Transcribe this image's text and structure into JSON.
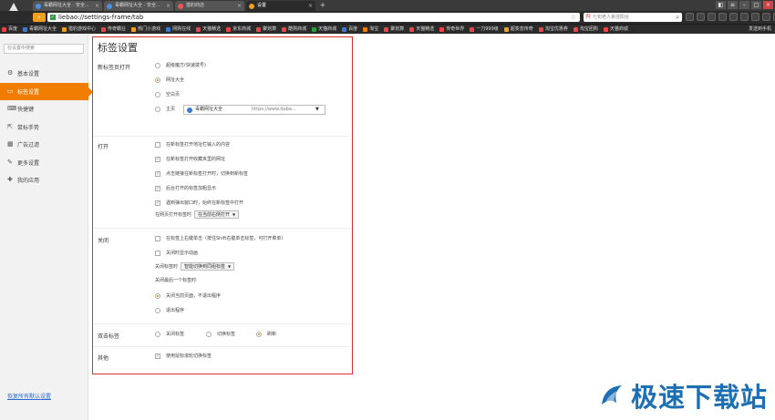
{
  "tabs": [
    {
      "label": "毒霸网址大全 - 安全...",
      "active": false
    },
    {
      "label": "毒霸网址大全 - 安全...",
      "active": false
    },
    {
      "label": "猎豹商店",
      "active": false
    },
    {
      "label": "设置",
      "active": true
    }
  ],
  "address": {
    "url": "liebao://settings-frame/tab"
  },
  "search": {
    "value": "七旬老人悬挂阳台"
  },
  "bookmarks": [
    "百度",
    "毒霸网址大全",
    "猎豹游戏中心",
    "传奇霸业",
    "热门小游戏",
    "网购在线",
    "天猫精选",
    "京东商城",
    "聚划算",
    "酷购商城",
    "天猫商城",
    "百度",
    "淘宝",
    "聚划算",
    "天猫精选",
    "传奇世界",
    "一刀999级",
    "超变态传奇",
    "淘宝优惠券",
    "淘宝团购",
    "天猫商城"
  ],
  "bookmarks_right": "发送到手机",
  "sidebar": {
    "search_placeholder": "在设置中搜索",
    "items": [
      {
        "label": "基本设置",
        "icon": "gear-icon",
        "active": false
      },
      {
        "label": "标签设置",
        "icon": "tab-icon",
        "active": true
      },
      {
        "label": "快捷键",
        "icon": "keyboard-icon",
        "active": false
      },
      {
        "label": "鼠标手势",
        "icon": "mouse-icon",
        "active": false
      },
      {
        "label": "广告过滤",
        "icon": "filter-icon",
        "active": false
      },
      {
        "label": "更多设置",
        "icon": "wrench-icon",
        "active": false
      },
      {
        "label": "我的应用",
        "icon": "apps-icon",
        "active": false
      }
    ],
    "restore_label": "恢复所有默认设置"
  },
  "page": {
    "title": "标签设置",
    "newtab": {
      "label": "新标签页打开",
      "options": [
        "超级魔方(快速拨号)",
        "网址大全",
        "空白页",
        "主页"
      ],
      "selected": 1,
      "homepage_name": "毒霸网址大全",
      "homepage_url": "https://www.duba..."
    },
    "open": {
      "label": "打开",
      "checks": [
        {
          "label": "在新标签打开地址栏输入的内容",
          "checked": false
        },
        {
          "label": "在新标签打开收藏夹里的网址",
          "checked": true
        },
        {
          "label": "点击链接在新标签打开时，切换到新标签",
          "checked": true
        },
        {
          "label": "后台打开的标签加粗显示",
          "checked": true
        },
        {
          "label": "遇到弹出窗口时，始终在新标签中打开",
          "checked": true
        }
      ],
      "position_label": "在网页打开标签时",
      "position_value": "在当前右侧打开"
    },
    "close": {
      "label": "关闭",
      "checks": [
        {
          "label": "在标签上右键单击（按住Shift右键单击标签，可打开菜单）",
          "checked": false
        },
        {
          "label": "关闭时显示动画",
          "checked": false
        }
      ],
      "switch_label": "关闭标签时",
      "switch_value": "智能切换到同组标签",
      "last_label": "关闭最后一个标签时:",
      "last_options": [
        "关闭当前页面，不退出程序",
        "退出程序"
      ],
      "last_selected": 0
    },
    "dblclick": {
      "label": "双击标签",
      "options": [
        "关闭标签",
        "切换标签",
        "刷新"
      ],
      "selected": 2
    },
    "other": {
      "label": "其他",
      "checks": [
        {
          "label": "使用鼠标滚轮切换标签",
          "checked": true
        }
      ]
    }
  },
  "watermark": {
    "text": "极速下载站"
  },
  "colors": {
    "accent": "#f07c00",
    "highlight_border": "#e03030",
    "chrome": "#2b2b2b"
  }
}
